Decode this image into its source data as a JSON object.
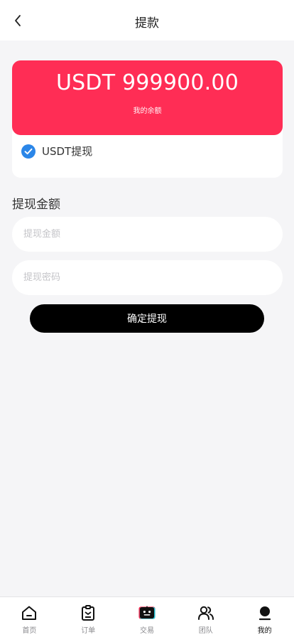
{
  "header": {
    "title": "提款",
    "back_icon": "chevron-left-icon"
  },
  "balance": {
    "amount": "USDT 999900.00",
    "label": "我的余额",
    "color": "#ff2d55"
  },
  "method": {
    "label": "USDT提现",
    "selected": true,
    "check_color": "#2b86e8"
  },
  "form": {
    "section_title": "提现金额",
    "amount_placeholder": "提现金额",
    "password_placeholder": "提现密码",
    "submit_label": "确定提现"
  },
  "nav": {
    "items": [
      {
        "label": "首页",
        "icon": "home-icon"
      },
      {
        "label": "订单",
        "icon": "clipboard-icon"
      },
      {
        "label": "交易",
        "icon": "robot-icon"
      },
      {
        "label": "团队",
        "icon": "team-icon"
      },
      {
        "label": "我的",
        "icon": "user-icon",
        "active": true
      }
    ]
  }
}
